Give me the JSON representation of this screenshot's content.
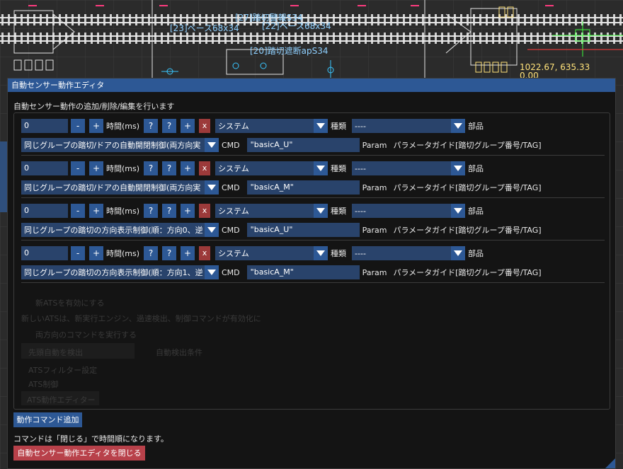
{
  "background": {
    "labels": [
      "[27]踏切警報S34",
      "[23]ベース68x34",
      "[22]ベース68x34",
      "[20]踏切遮断apS34"
    ],
    "coordinate": "1022.67,  635.33",
    "coordinate2": "0.00"
  },
  "window": {
    "title": "自動センサー動作エディタ",
    "description": "自動センサー動作の追加/削除/編集を行います",
    "ghost_texts": [
      "新ATSを有効にする",
      "新しいATSは、新実行エンジン、過速検出、制御コマンドが有効化に",
      "両方向のコマンドを実行する",
      "先頭自動を検出",
      "自動検出条件",
      "ATSフィルター設定",
      "ATS制御",
      "ATS動作エディター"
    ],
    "entries": [
      {
        "time": "0",
        "minus": "-",
        "plus": "+",
        "time_label": "時間(ms)",
        "q1": "?",
        "q2": "?",
        "add": "+",
        "remove": "x",
        "type_value": "システム",
        "type_label": "種類",
        "part_value": "----",
        "part_label": "部品",
        "action": "同じグループの踏切/ドアの自動開閉制御(両方向実",
        "cmd_label": "CMD",
        "cmd_value": "\"basicA_U\"",
        "param_label": "Param",
        "param_guide": "パラメータガイド[踏切グループ番号/TAG]"
      },
      {
        "time": "0",
        "minus": "-",
        "plus": "+",
        "time_label": "時間(ms)",
        "q1": "?",
        "q2": "?",
        "add": "+",
        "remove": "x",
        "type_value": "システム",
        "type_label": "種類",
        "part_value": "----",
        "part_label": "部品",
        "action": "同じグループの踏切/ドアの自動開閉制御(両方向実",
        "cmd_label": "CMD",
        "cmd_value": "\"basicA_M\"",
        "param_label": "Param",
        "param_guide": "パラメータガイド[踏切グループ番号/TAG]"
      },
      {
        "time": "0",
        "minus": "-",
        "plus": "+",
        "time_label": "時間(ms)",
        "q1": "?",
        "q2": "?",
        "add": "+",
        "remove": "x",
        "type_value": "システム",
        "type_label": "種類",
        "part_value": "----",
        "part_label": "部品",
        "action": "同じグループの踏切の方向表示制御(順：方向0、逆",
        "cmd_label": "CMD",
        "cmd_value": "\"basicA_U\"",
        "param_label": "Param",
        "param_guide": "パラメータガイド[踏切グループ番号/TAG]"
      },
      {
        "time": "0",
        "minus": "-",
        "plus": "+",
        "time_label": "時間(ms)",
        "q1": "?",
        "q2": "?",
        "add": "+",
        "remove": "x",
        "type_value": "システム",
        "type_label": "種類",
        "part_value": "----",
        "part_label": "部品",
        "action": "同じグループの踏切の方向表示制御(順：方向1、逆",
        "cmd_label": "CMD",
        "cmd_value": "\"basicA_M\"",
        "param_label": "Param",
        "param_guide": "パラメータガイド[踏切グループ番号/TAG]"
      }
    ],
    "add_button": "動作コマンド追加",
    "note": "コマンドは「閉じる」で時間順になります。",
    "close_button": "自動センサー動作エディタを閉じる"
  },
  "colors": {
    "titlebar": "#2d5895",
    "button": "#2d5895",
    "field": "#29436b",
    "remove": "#9c3a3a",
    "close": "#b8414a"
  }
}
